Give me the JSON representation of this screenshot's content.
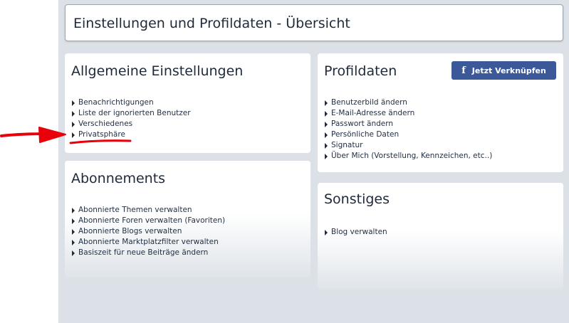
{
  "page_title": "Einstellungen und Profildaten - Übersicht",
  "general": {
    "title": "Allgemeine Einstellungen",
    "items": [
      "Benachrichtigungen",
      "Liste der ignorierten Benutzer",
      "Verschiedenes",
      "Privatsphäre"
    ]
  },
  "profile": {
    "title": "Profildaten",
    "connect_button": "Jetzt Verknüpfen",
    "items": [
      "Benutzerbild ändern",
      "E-Mail-Adresse ändern",
      "Passwort ändern",
      "Persönliche Daten",
      "Signatur",
      "Über Mich (Vorstellung, Kennzeichen, etc..)"
    ]
  },
  "subscriptions": {
    "title": "Abonnements",
    "items": [
      "Abonnierte Themen verwalten",
      "Abonnierte Foren verwalten (Favoriten)",
      "Abonnierte Blogs verwalten",
      "Abonnierte Marktplatzfilter verwalten",
      "Basiszeit für neue Beiträge ändern"
    ]
  },
  "other": {
    "title": "Sonstiges",
    "items": [
      "Blog verwalten"
    ]
  },
  "colors": {
    "background": "#dbe1e6",
    "facebook": "#3b5998",
    "annotation": "#e8000b"
  },
  "icons": {
    "facebook": "facebook-icon",
    "bullet": "triangle-right-icon"
  }
}
